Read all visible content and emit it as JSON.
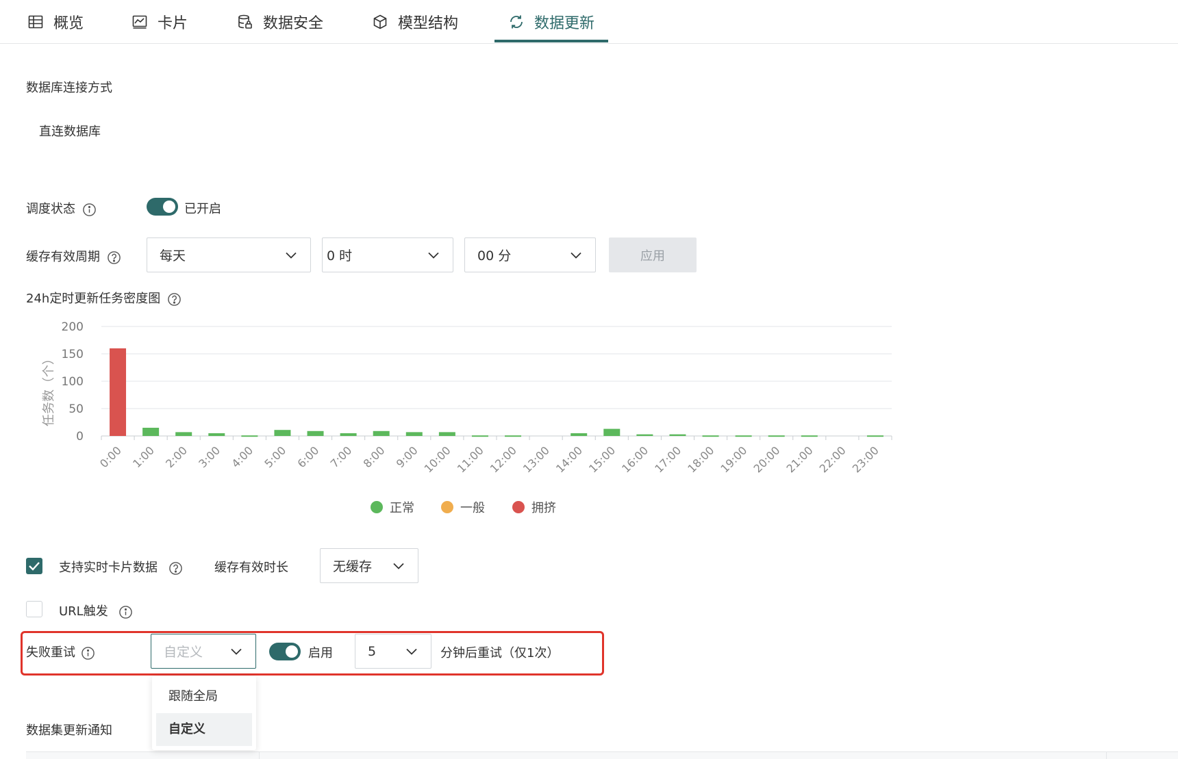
{
  "tabs": [
    {
      "label": "概览",
      "icon": "table-icon",
      "active": false
    },
    {
      "label": "卡片",
      "icon": "chart-line-icon",
      "active": false
    },
    {
      "label": "数据安全",
      "icon": "database-lock-icon",
      "active": false
    },
    {
      "label": "模型结构",
      "icon": "cube-icon",
      "active": false
    },
    {
      "label": "数据更新",
      "icon": "refresh-icon",
      "active": true
    }
  ],
  "connection": {
    "title": "数据库连接方式",
    "value": "直连数据库"
  },
  "schedule": {
    "label": "调度状态",
    "toggle_on": true,
    "status_text": "已开启"
  },
  "cache_period": {
    "label": "缓存有效周期",
    "frequency": "每天",
    "hour": "0 时",
    "minute": "00 分",
    "apply_label": "应用"
  },
  "density_chart": {
    "title": "24h定时更新任务密度图",
    "legend": [
      {
        "name": "正常",
        "color": "#5cb85c"
      },
      {
        "name": "一般",
        "color": "#f0ad4e"
      },
      {
        "name": "拥挤",
        "color": "#d9534f"
      }
    ]
  },
  "chart_data": {
    "type": "bar",
    "ylabel": "任务数（个）",
    "ylim": [
      0,
      200
    ],
    "yticks": [
      0,
      50,
      100,
      150,
      200
    ],
    "categories": [
      "0:00",
      "1:00",
      "2:00",
      "3:00",
      "4:00",
      "5:00",
      "6:00",
      "7:00",
      "8:00",
      "9:00",
      "10:00",
      "11:00",
      "12:00",
      "13:00",
      "14:00",
      "15:00",
      "16:00",
      "17:00",
      "18:00",
      "19:00",
      "20:00",
      "21:00",
      "22:00",
      "23:00"
    ],
    "values": [
      160,
      15,
      7,
      5,
      1,
      11,
      9,
      5,
      9,
      7,
      7,
      1,
      1,
      0,
      5,
      13,
      3,
      3,
      1,
      1,
      1,
      1,
      0,
      1
    ],
    "status": [
      "拥挤",
      "正常",
      "正常",
      "正常",
      "正常",
      "正常",
      "正常",
      "正常",
      "正常",
      "正常",
      "正常",
      "正常",
      "正常",
      "正常",
      "正常",
      "正常",
      "正常",
      "正常",
      "正常",
      "正常",
      "正常",
      "正常",
      "正常",
      "正常"
    ],
    "grid": true,
    "legend_position": "bottom"
  },
  "realtime": {
    "checked": true,
    "label": "支持实时卡片数据",
    "duration_label": "缓存有效时长",
    "duration_value": "无缓存"
  },
  "url_trigger": {
    "checked": false,
    "label": "URL触发"
  },
  "retry": {
    "label": "失败重试",
    "mode_placeholder": "自定义",
    "toggle_on": true,
    "toggle_text": "启用",
    "minutes": "5",
    "suffix": "分钟后重试（仅1次）",
    "highlight_color": "#e0342b",
    "options": [
      "跟随全局",
      "自定义"
    ],
    "selected_option": "自定义"
  },
  "notify": {
    "title": "数据集更新通知"
  }
}
